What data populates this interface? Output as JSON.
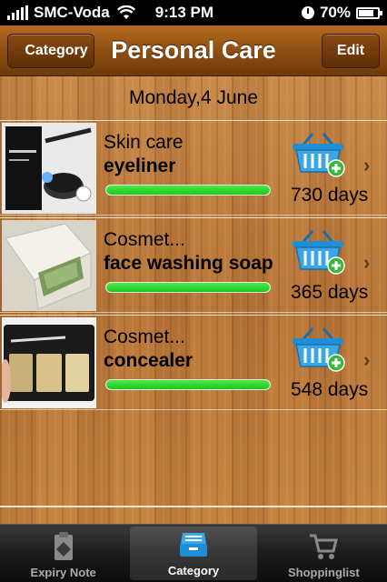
{
  "status_bar": {
    "carrier": "SMC-Voda",
    "time": "9:13 PM",
    "battery": "70%"
  },
  "nav": {
    "back_label": "Category",
    "title": "Personal Care",
    "edit_label": "Edit"
  },
  "date_header": "Monday,4 June",
  "items": [
    {
      "category": "Skin care",
      "name": "eyeliner",
      "days": "730 days",
      "progress": 1.0
    },
    {
      "category": "Cosmet...",
      "name": "face washing soap",
      "days": "365 days",
      "progress": 1.0
    },
    {
      "category": "Cosmet...",
      "name": "concealer",
      "days": "548 days",
      "progress": 1.0
    }
  ],
  "tabs": [
    {
      "label": "Expiry Note",
      "icon": "clipboard-icon",
      "active": false
    },
    {
      "label": "Category",
      "icon": "tray-icon",
      "active": true
    },
    {
      "label": "Shoppinglist",
      "icon": "cart-icon",
      "active": false
    }
  ],
  "colors": {
    "nav_brown": "#8c4d10",
    "progress_green": "#2bd62b",
    "basket_blue": "#1e8fd6",
    "plus_green": "#38b838"
  }
}
